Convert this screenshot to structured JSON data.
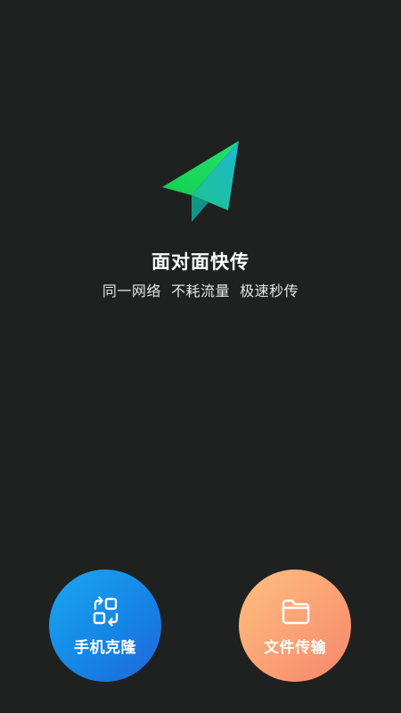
{
  "hero": {
    "icon": "paper-plane-icon",
    "title": "面对面快传",
    "subtitle": "同一网络  不耗流量  极速秒传"
  },
  "actions": [
    {
      "label": "手机克隆",
      "icon": "phone-clone-icon",
      "color_start": "#1ba7ef",
      "color_end": "#2066d8"
    },
    {
      "label": "文件传输",
      "icon": "folder-icon",
      "color_start": "#fdc07d",
      "color_end": "#f6866d"
    }
  ],
  "colors": {
    "background": "#1f2020",
    "plane_light": "#1fd65a",
    "plane_dark": "#17a8c8"
  }
}
